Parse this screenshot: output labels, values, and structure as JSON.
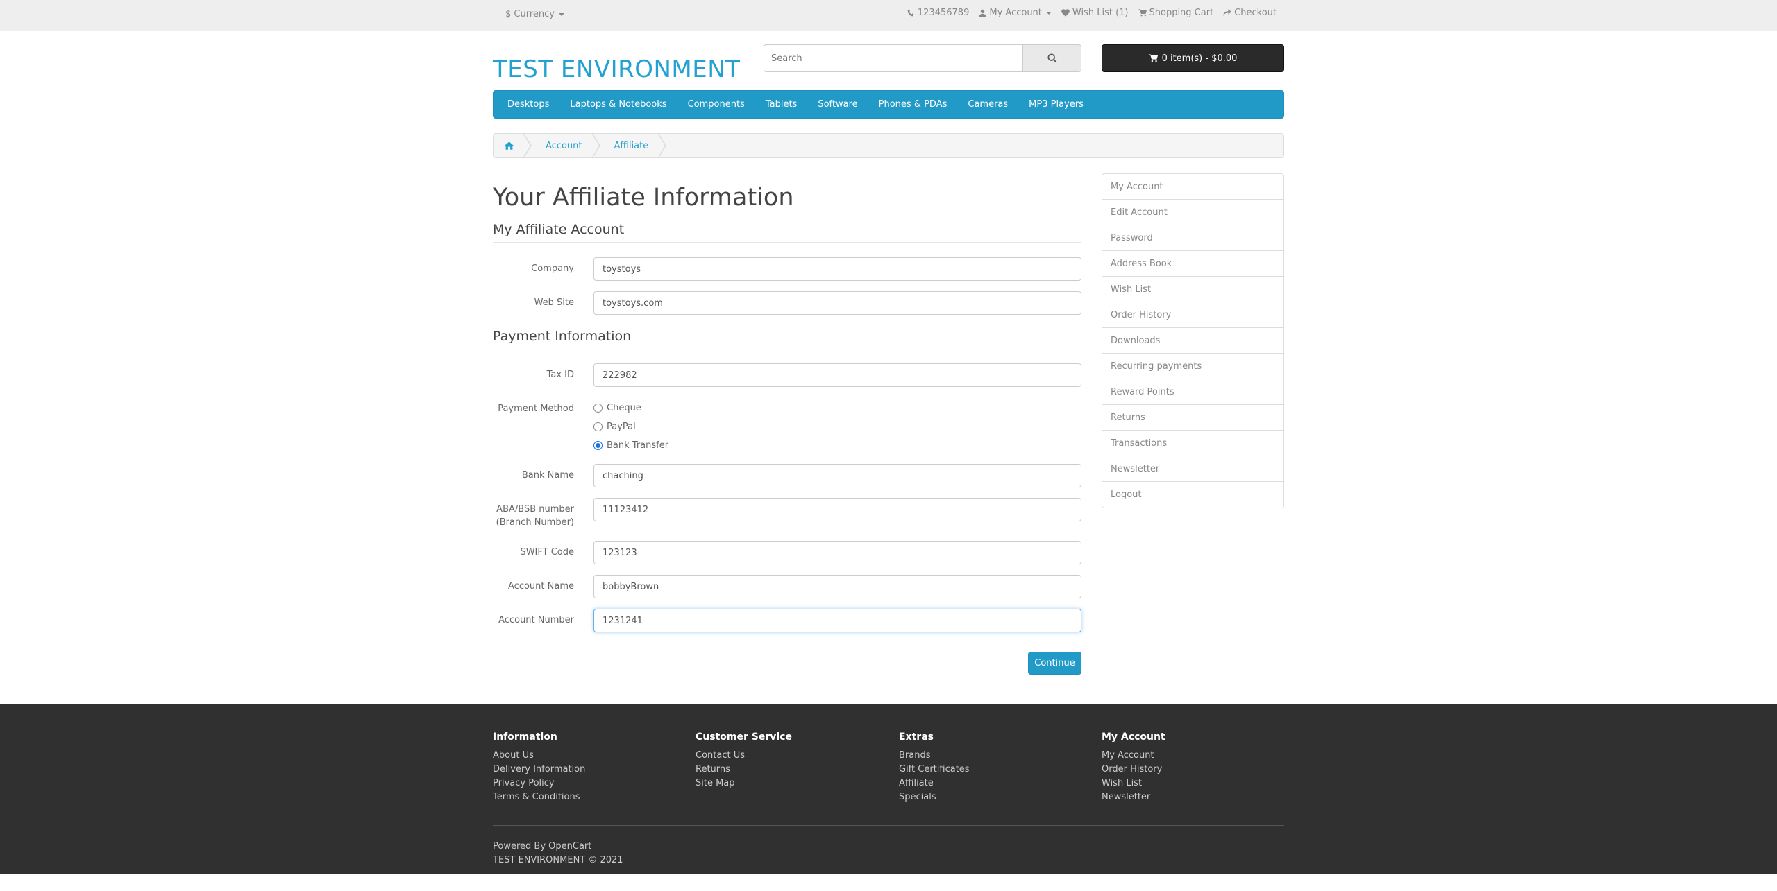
{
  "topbar": {
    "currency": "$ Currency",
    "phone": "123456789",
    "my_account": "My Account",
    "wishlist": "Wish List (1)",
    "shopping_cart": "Shopping Cart",
    "checkout": "Checkout"
  },
  "header": {
    "logo": "TEST ENVIRONMENT",
    "search_placeholder": "Search",
    "cart": "0 item(s) - $0.00"
  },
  "menu": [
    "Desktops",
    "Laptops & Notebooks",
    "Components",
    "Tablets",
    "Software",
    "Phones & PDAs",
    "Cameras",
    "MP3 Players"
  ],
  "breadcrumb": {
    "account": "Account",
    "affiliate": "Affiliate"
  },
  "page": {
    "title": "Your Affiliate Information",
    "section_affiliate": "My Affiliate Account",
    "section_payment": "Payment Information",
    "continue": "Continue"
  },
  "form": {
    "company": {
      "label": "Company",
      "value": "toystoys"
    },
    "website": {
      "label": "Web Site",
      "value": "toystoys.com"
    },
    "tax_id": {
      "label": "Tax ID",
      "value": "222982"
    },
    "payment_method": {
      "label": "Payment Method",
      "options": [
        "Cheque",
        "PayPal",
        "Bank Transfer"
      ],
      "selected": "Bank Transfer"
    },
    "bank_name": {
      "label": "Bank Name",
      "value": "chaching"
    },
    "aba_bsb": {
      "label_line1": "ABA/BSB number",
      "label_line2": "(Branch Number)",
      "value": "11123412"
    },
    "swift": {
      "label": "SWIFT Code",
      "value": "123123"
    },
    "account_name": {
      "label": "Account Name",
      "value": "bobbyBrown"
    },
    "account_number": {
      "label": "Account Number",
      "value": "1231241"
    }
  },
  "sidebar": [
    "My Account",
    "Edit Account",
    "Password",
    "Address Book",
    "Wish List",
    "Order History",
    "Downloads",
    "Recurring payments",
    "Reward Points",
    "Returns",
    "Transactions",
    "Newsletter",
    "Logout"
  ],
  "footer": {
    "information": {
      "title": "Information",
      "links": [
        "About Us",
        "Delivery Information",
        "Privacy Policy",
        "Terms & Conditions"
      ]
    },
    "customer_service": {
      "title": "Customer Service",
      "links": [
        "Contact Us",
        "Returns",
        "Site Map"
      ]
    },
    "extras": {
      "title": "Extras",
      "links": [
        "Brands",
        "Gift Certificates",
        "Affiliate",
        "Specials"
      ]
    },
    "my_account": {
      "title": "My Account",
      "links": [
        "My Account",
        "Order History",
        "Wish List",
        "Newsletter"
      ]
    },
    "powered_prefix": "Powered By",
    "powered_link": "OpenCart",
    "copyright": "TEST ENVIRONMENT © 2021"
  },
  "colors": {
    "accent": "#229ac8",
    "link": "#23a1d1",
    "footer_bg": "#303030",
    "topbar_bg": "#eeeeee"
  }
}
